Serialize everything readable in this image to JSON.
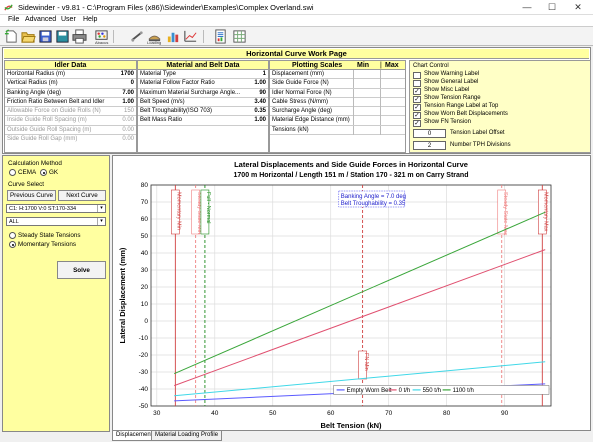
{
  "window": {
    "title": "Sidewinder - v9.81 - C:\\Program Files (x86)\\Sidewinder\\Examples\\Complex Overland.swi",
    "minimize": "—",
    "maximize": "☐",
    "close": "✕"
  },
  "menu": [
    "File",
    "Advanced",
    "User",
    "Help"
  ],
  "toolbar": {
    "abacus_label": "Abacus",
    "loading_label": "Loading"
  },
  "work_page": {
    "title": "Horizontal Curve Work Page",
    "idler": {
      "head": "Idler Data",
      "rows": [
        {
          "label": "Horizontal Radius (m)",
          "value": "1700"
        },
        {
          "label": "Vertical Radius (m)",
          "value": "0"
        },
        {
          "label": "Banking Angle (deg)",
          "value": "7.00"
        },
        {
          "label": "Friction Ratio Between Belt and Idler",
          "value": "1.00"
        },
        {
          "label": "Allowable Force on Guide Rolls (N)",
          "value": "150"
        },
        {
          "label": "Inside Guide Roll Spacing (m)",
          "value": "0.00"
        },
        {
          "label": "Outside Guide Roll Spacing (m)",
          "value": "0.00"
        },
        {
          "label": "Side Guide Roll Gap (mm)",
          "value": "0.00"
        }
      ]
    },
    "material": {
      "head": "Material and Belt Data",
      "rows": [
        {
          "label": "Material Type",
          "value": "1"
        },
        {
          "label": "Material Follow Factor Ratio",
          "value": "1.00"
        },
        {
          "label": "Maximum Material Surcharge Angle...",
          "value": "90"
        },
        {
          "label": "Belt Speed (m/s)",
          "value": "3.40"
        },
        {
          "label": "Belt Troughability(ISO 703)",
          "value": "0.35"
        },
        {
          "label": "Belt Mass Ratio",
          "value": "1.00"
        }
      ]
    },
    "plotting": {
      "head": "Plotting Scales",
      "min": "Min",
      "max": "Max",
      "rows": [
        "Displacement (mm)",
        "Side Guide Force (N)",
        "Idler Normal Force (N)",
        "Cable Stress (N/mm)",
        "Surcharge Angle (deg)",
        "Material Edge Distance (mm)",
        "Tensions (kN)"
      ]
    },
    "chart_control": {
      "title": "Chart Control",
      "items": [
        {
          "label": "Show Warning Label",
          "checked": false
        },
        {
          "label": "Show General Label",
          "checked": false
        },
        {
          "label": "Show Misc Label",
          "checked": true
        },
        {
          "label": "Show Tension Range",
          "checked": true
        },
        {
          "label": "Tension Range Label at Top",
          "checked": true
        },
        {
          "label": "Show Worn Belt Displacements",
          "checked": true
        },
        {
          "label": "Show FN Tension",
          "checked": true
        }
      ],
      "offset_value": "0",
      "offset_label": "Tension Label Offset",
      "divisions_value": "2",
      "divisions_label": "Number TPH Divisions",
      "check": "✓"
    }
  },
  "left_panel": {
    "calc_method": "Calculation Method",
    "radio_cema": "CEMA",
    "radio_gk": "GK",
    "curve_select": "Curve Select",
    "prev_curve": "Previous Curve",
    "next_curve": "Next Curve",
    "curve_value": "C1: H:1700 V:0 ST:170-334",
    "filter_value": "ALL",
    "steady": "Steady State Tensions",
    "momentary": "Momentary Tensions",
    "solve": "Solve",
    "dd": "▾"
  },
  "chart_data": {
    "type": "line",
    "title": "Lateral Displacements and Side Guide Forces in Horizontal Curve",
    "subtitle": "1700 m Horizontal / Length 151 m / Station 170 - 321 m on Carry Strand",
    "xlabel": "Belt Tension (kN)",
    "ylabel": "Lateral Displacement (mm)",
    "xlim": [
      29,
      98
    ],
    "ylim": [
      -50,
      80
    ],
    "xticks": [
      30,
      40,
      50,
      60,
      70,
      80,
      90
    ],
    "yticks": [
      -50,
      -40,
      -30,
      -20,
      -10,
      0,
      10,
      20,
      30,
      40,
      50,
      60,
      70,
      80
    ],
    "grid": true,
    "annotation_lines": [
      "Banking Angle = 7.0 deg",
      "Belt Troughability = 0.35"
    ],
    "vertical_markers": [
      {
        "x": 33.2,
        "label": "Momentary Min",
        "color": "#d04040",
        "style": "solid"
      },
      {
        "x": 36.7,
        "label": "Steady State Min",
        "color": "#ee8080",
        "style": "dashed"
      },
      {
        "x": 38.3,
        "label": "Full - Normal",
        "color": "#1a8a1a",
        "style": "dashed"
      },
      {
        "x": 65.5,
        "label": "FN Min",
        "color": "#d04040",
        "style": "dashed"
      },
      {
        "x": 89.5,
        "label": "Steady State Max",
        "color": "#ee8080",
        "style": "dashed"
      },
      {
        "x": 96.5,
        "label": "Momentary Max",
        "color": "#d04040",
        "style": "solid"
      }
    ],
    "series": [
      {
        "name": "Empty Worn Belt",
        "color": "#5a5aff",
        "x": [
          33,
          97
        ],
        "y": [
          -47,
          -37
        ],
        "legend": true
      },
      {
        "name": "0 t/h",
        "color": "#e05070",
        "x": [
          33,
          97
        ],
        "y": [
          -38,
          42
        ],
        "legend": true
      },
      {
        "name": "550 t/h",
        "color": "#40d8e8",
        "x": [
          33,
          97
        ],
        "y": [
          -44,
          -24
        ],
        "legend": true
      },
      {
        "name": "1100 t/h",
        "color": "#3aa63a",
        "x": [
          33,
          97
        ],
        "y": [
          -31,
          64
        ],
        "legend": true
      }
    ],
    "legend_placement": "bottom-right",
    "legend_labels": [
      "Empty Worn Belt",
      "0 t/h",
      "550 t/h",
      "1100 t/h"
    ]
  },
  "tabs": [
    "Displacement",
    "Material Loading Profile"
  ],
  "colors": {
    "yellow": "#ffffa0",
    "light_yellow": "#ffffc6"
  }
}
